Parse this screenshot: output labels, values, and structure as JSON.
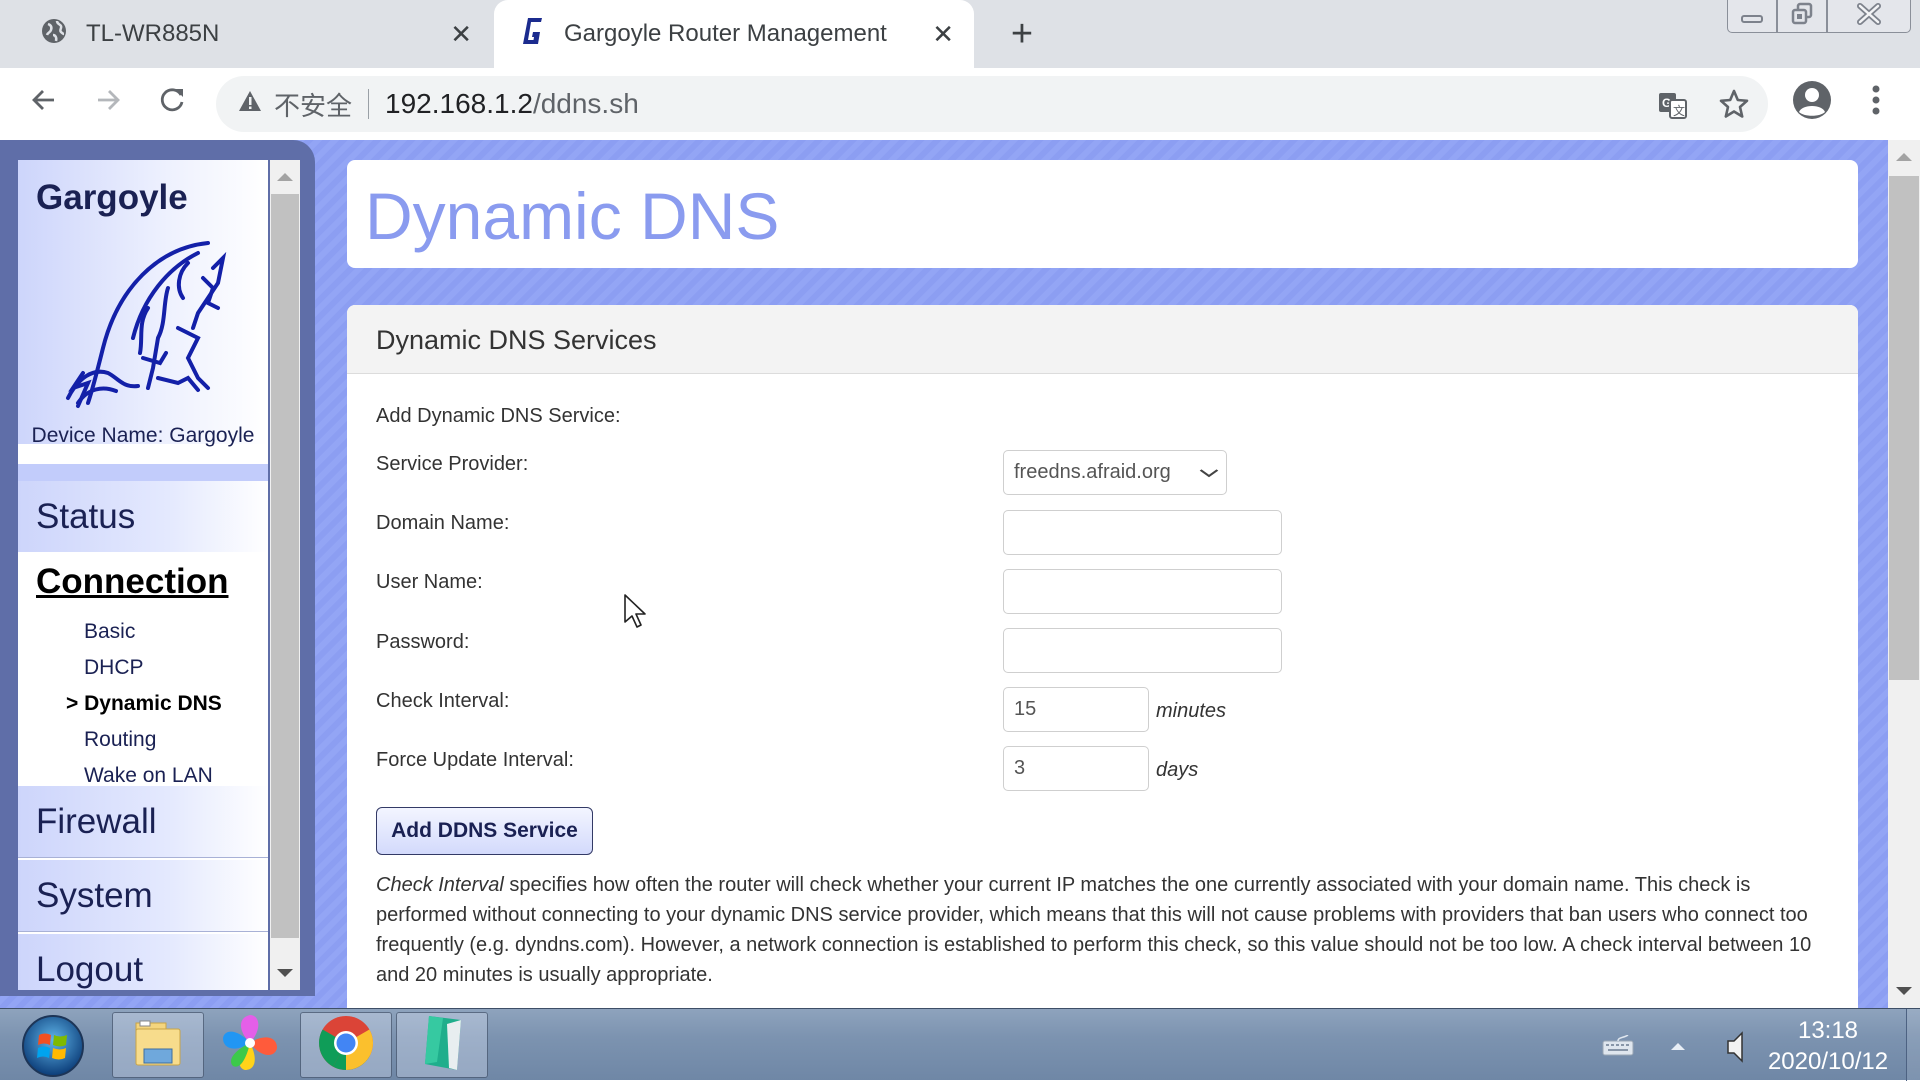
{
  "browser": {
    "tabs": [
      {
        "title": "TL-WR885N",
        "icon": "globe-icon",
        "active": false
      },
      {
        "title": "Gargoyle Router Management",
        "icon": "gargoyle-g-icon",
        "active": true
      }
    ],
    "tab_close_glyph": "✕",
    "new_tab_glyph": "+",
    "address": {
      "security_label": "不安全",
      "host": "192.168.1.2",
      "path": "/ddns.sh"
    },
    "toolbar_icons": [
      "back-icon",
      "forward-icon",
      "reload-icon",
      "translate-icon",
      "bookmark-star-icon",
      "profile-icon",
      "menu-kebab-icon"
    ],
    "window_controls": [
      "minimize",
      "restore",
      "close"
    ]
  },
  "sidebar": {
    "brand": "Gargoyle",
    "device_name": "Device Name: Gargoyle",
    "menu": [
      {
        "label": "Status"
      },
      {
        "label": "Connection",
        "current": true,
        "subitems": [
          {
            "label": "Basic"
          },
          {
            "label": "DHCP"
          },
          {
            "label": "> Dynamic DNS",
            "selected": true
          },
          {
            "label": "Routing"
          },
          {
            "label": "Wake on LAN"
          }
        ]
      },
      {
        "label": "Firewall"
      },
      {
        "label": "System"
      },
      {
        "label": "Logout"
      }
    ]
  },
  "main": {
    "page_title": "Dynamic DNS",
    "section_title": "Dynamic DNS Services",
    "form": {
      "heading": "Add Dynamic DNS Service:",
      "service_provider": {
        "label": "Service Provider:",
        "value": "freedns.afraid.org"
      },
      "domain_name": {
        "label": "Domain Name:",
        "value": ""
      },
      "user_name": {
        "label": "User Name:",
        "value": ""
      },
      "password": {
        "label": "Password:",
        "value": ""
      },
      "check_interval": {
        "label": "Check Interval:",
        "value": "15",
        "unit": "minutes"
      },
      "force_update_interval": {
        "label": "Force Update Interval:",
        "value": "3",
        "unit": "days"
      },
      "add_button": "Add DDNS Service"
    },
    "help": {
      "term": "Check Interval",
      "text": " specifies how often the router will check whether your current IP matches the one currently associated with your domain name. This check is performed without connecting to your dynamic DNS service provider, which means that this will not cause problems with providers that ban users who connect too frequently (e.g. dyndns.com). However, a network connection is established to perform this check, so this value should not be too low. A check interval between 10 and 20 minutes is usually appropriate."
    }
  },
  "taskbar": {
    "apps": [
      "start-orb",
      "file-explorer",
      "pinwheel-app",
      "chrome",
      "notepad-app"
    ],
    "time": "13:18",
    "date": "2020/10/12"
  }
}
